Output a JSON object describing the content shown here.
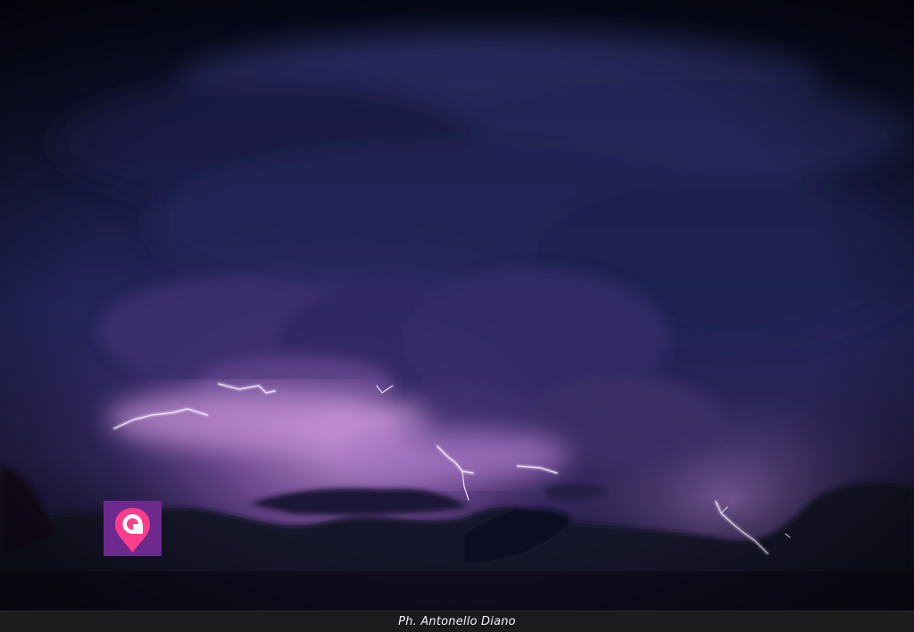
{
  "photo": {
    "subject": "storm-clouds-with-lightning",
    "colors": {
      "sky_top": "#0a0c1c",
      "sky_mid": "#1f2150",
      "glow": "#b07ac8",
      "cloud_dark": "#141227",
      "lightning": "#f4e8ff"
    }
  },
  "logo": {
    "icon": "map-pin-icon",
    "background": "#6b2a8c",
    "pin_color": "#ff3d8a"
  },
  "caption": {
    "text": "Ph. Antonello Diano"
  }
}
